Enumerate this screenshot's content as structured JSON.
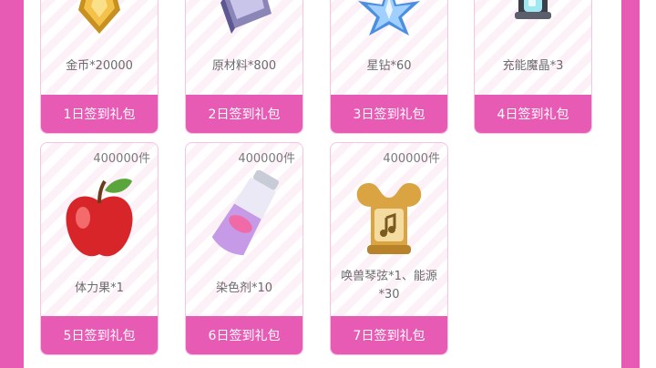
{
  "rewards": [
    {
      "name": "金币*20000",
      "day": "1日签到礼包"
    },
    {
      "name": "原材料*800",
      "day": "2日签到礼包"
    },
    {
      "name": "星钻*60",
      "day": "3日签到礼包"
    },
    {
      "name": "充能魔晶*3",
      "day": "4日签到礼包"
    },
    {
      "qty": "400000件",
      "name": "体力果*1",
      "day": "5日签到礼包"
    },
    {
      "qty": "400000件",
      "name": "染色剂*10",
      "day": "6日签到礼包"
    },
    {
      "qty": "400000件",
      "name": "唤兽琴弦*1、能源*30",
      "day": "7日签到礼包"
    }
  ],
  "colors": {
    "accent": "#e85bb5",
    "card_border": "#f6c3e1"
  }
}
